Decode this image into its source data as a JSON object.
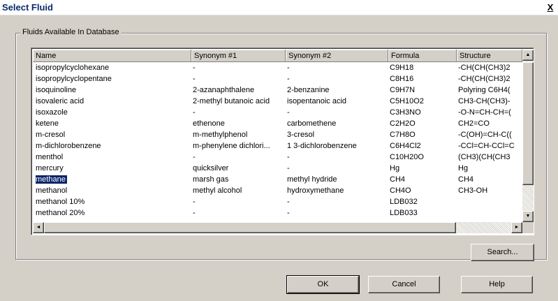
{
  "window": {
    "title": "Select Fluid",
    "close_glyph": "X"
  },
  "group": {
    "label": "Fluids Available In Database"
  },
  "table": {
    "columns": [
      "Name",
      "Synonym #1",
      "Synonym #2",
      "Formula",
      "Structure"
    ],
    "rows": [
      [
        "isopropylcyclohexane",
        "-",
        "-",
        "C9H18",
        "-CH(CH(CH3)2"
      ],
      [
        "isopropylcyclopentane",
        "-",
        "-",
        "C8H16",
        "-CH(CH(CH3)2"
      ],
      [
        "isoquinoline",
        "2-azanaphthalene",
        "2-benzanine",
        "C9H7N",
        "Polyring C6H4("
      ],
      [
        "isovaleric acid",
        "2-methyl butanoic acid",
        "isopentanoic acid",
        "C5H10O2",
        "CH3-CH(CH3)-"
      ],
      [
        "isoxazole",
        "-",
        "-",
        "C3H3NO",
        "-O-N=CH-CH=("
      ],
      [
        "ketene",
        "ethenone",
        "carbomethene",
        "C2H2O",
        "CH2=CO"
      ],
      [
        "m-cresol",
        "m-methylphenol",
        "3-cresol",
        "C7H8O",
        "-C(OH)=CH-C(("
      ],
      [
        "m-dichlorobenzene",
        "m-phenylene dichlori...",
        "1 3-dichlorobenzene",
        "C6H4Cl2",
        "-CCl=CH-CCl=C"
      ],
      [
        "menthol",
        "-",
        "-",
        "C10H20O",
        "(CH3)(CH(CH3"
      ],
      [
        "mercury",
        "quicksilver",
        "-",
        "Hg",
        "Hg"
      ],
      [
        "methane",
        "marsh gas",
        "methyl hydride",
        "CH4",
        "CH4"
      ],
      [
        "methanol",
        "methyl alcohol",
        "hydroxymethane",
        "CH4O",
        "CH3-OH"
      ],
      [
        "methanol 10%",
        "-",
        "-",
        "LDB032",
        ""
      ],
      [
        "methanol 20%",
        "-",
        "-",
        "LDB033",
        ""
      ]
    ],
    "selected_index": 10
  },
  "scroll": {
    "up": "▲",
    "down": "▼",
    "left": "◄",
    "right": "►"
  },
  "buttons": {
    "search": "Search...",
    "ok": "OK",
    "cancel": "Cancel",
    "help": "Help"
  }
}
